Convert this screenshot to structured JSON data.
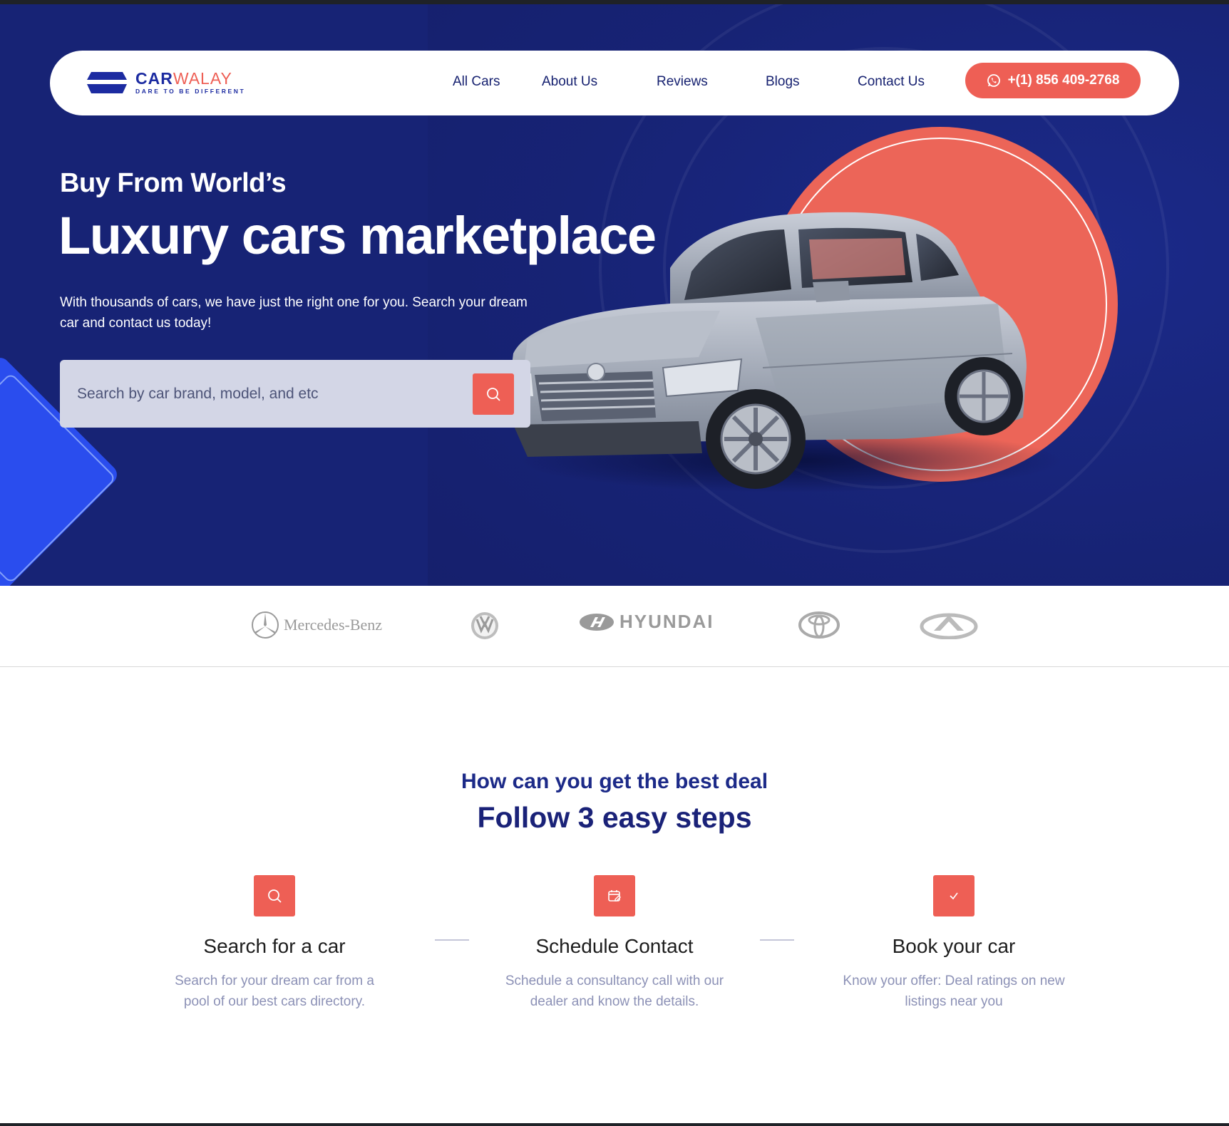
{
  "brand": {
    "name_part1": "CAR",
    "name_part2": "WALAY",
    "tagline": "DARE TO BE DIFFERENT"
  },
  "nav": {
    "links": [
      "All Cars",
      "About Us",
      "Reviews",
      "Blogs",
      "Contact Us"
    ],
    "phone": "+(1) 856 409-2768"
  },
  "hero": {
    "eyebrow": "Buy From World’s",
    "title": "Luxury cars marketplace",
    "subtitle": "With thousands of cars, we have just the right one for you. Search your dream car and contact us today!",
    "search_placeholder": "Search by car brand, model, and etc"
  },
  "brands": {
    "mercedes": "Mercedes-Benz",
    "hyundai": "HYUNDAI",
    "logos": [
      "mercedes-logo",
      "volkswagen-logo",
      "hyundai-logo",
      "toyota-logo",
      "infiniti-logo"
    ]
  },
  "steps": {
    "subtitle": "How can you get the best deal",
    "title": "Follow 3 easy steps",
    "items": [
      {
        "icon": "search-icon",
        "title": "Search for a car",
        "desc": "Search for your dream car from a pool of our best cars directory."
      },
      {
        "icon": "calendar-icon",
        "title": "Schedule Contact",
        "desc": "Schedule a consultancy call with our dealer and know the details."
      },
      {
        "icon": "check-icon",
        "title": "Book your car",
        "desc": "Know your offer: Deal ratings on new listings near you"
      }
    ]
  },
  "colors": {
    "hero_bg": "#172375",
    "accent": "#ee5f55",
    "navy_text": "#162170"
  }
}
